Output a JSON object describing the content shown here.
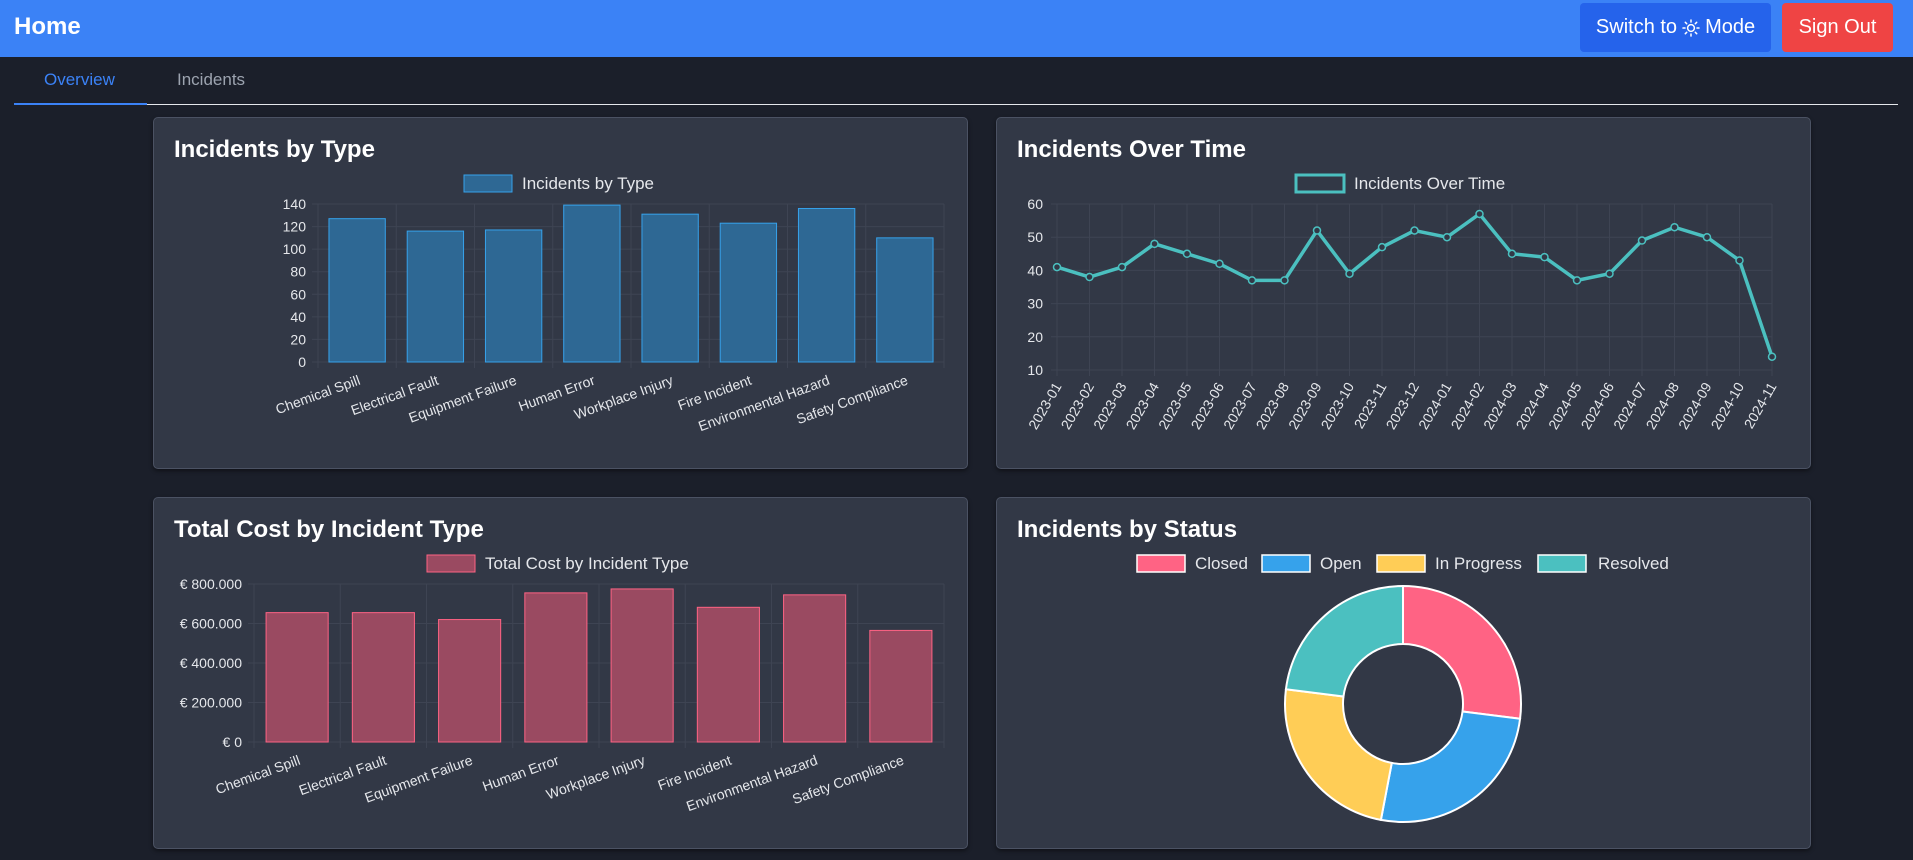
{
  "header": {
    "title": "Home",
    "theme_button": {
      "prefix": "Switch to",
      "icon": "sun-icon",
      "suffix": "Mode"
    },
    "signout_label": "Sign Out"
  },
  "tabs": [
    {
      "label": "Overview",
      "active": true
    },
    {
      "label": "Incidents",
      "active": false
    }
  ],
  "colors": {
    "header_bg": "#3b82f6",
    "accent": "#3b82f6",
    "signout": "#ef4444",
    "bar_blue": "#2e6894",
    "bar_red": "#9a4a61",
    "line_teal": "#4bc0c0",
    "pie": [
      "#ff6384",
      "#36a2eb",
      "#ffcd56",
      "#4bc0c0"
    ]
  },
  "charts": {
    "by_type": {
      "title": "Incidents by Type",
      "chart_data": {
        "type": "bar",
        "legend": "Incidents by Type",
        "categories": [
          "Chemical Spill",
          "Electrical Fault",
          "Equipment Failure",
          "Human Error",
          "Workplace Injury",
          "Fire Incident",
          "Environmental Hazard",
          "Safety Compliance"
        ],
        "values": [
          127,
          116,
          117,
          139,
          131,
          123,
          136,
          110
        ],
        "ylim": [
          0,
          140
        ],
        "yticks": [
          "0",
          "20",
          "40",
          "60",
          "80",
          "100",
          "120",
          "140"
        ]
      }
    },
    "over_time": {
      "title": "Incidents Over Time",
      "chart_data": {
        "type": "line",
        "legend": "Incidents Over Time",
        "x": [
          "2023-01",
          "2023-02",
          "2023-03",
          "2023-04",
          "2023-05",
          "2023-06",
          "2023-07",
          "2023-08",
          "2023-09",
          "2023-10",
          "2023-11",
          "2023-12",
          "2024-01",
          "2024-02",
          "2024-03",
          "2024-04",
          "2024-05",
          "2024-06",
          "2024-07",
          "2024-08",
          "2024-09",
          "2024-10",
          "2024-11"
        ],
        "values": [
          41,
          38,
          41,
          48,
          45,
          42,
          37,
          37,
          52,
          39,
          47,
          52,
          50,
          57,
          45,
          44,
          37,
          39,
          49,
          53,
          50,
          43,
          14
        ],
        "ylim": [
          10,
          60
        ],
        "yticks": [
          "10",
          "20",
          "30",
          "40",
          "50",
          "60"
        ]
      }
    },
    "cost_by_type": {
      "title": "Total Cost by Incident Type",
      "chart_data": {
        "type": "bar",
        "legend": "Total Cost by Incident Type",
        "categories": [
          "Chemical Spill",
          "Electrical Fault",
          "Equipment Failure",
          "Human Error",
          "Workplace Injury",
          "Fire Incident",
          "Environmental Hazard",
          "Safety Compliance"
        ],
        "values": [
          655000,
          655000,
          620000,
          755000,
          775000,
          682000,
          745000,
          565000
        ],
        "ylim": [
          0,
          800000
        ],
        "yticks": [
          "€ 0",
          "€ 200.000",
          "€ 400.000",
          "€ 600.000",
          "€ 800.000"
        ]
      }
    },
    "by_status": {
      "title": "Incidents by Status",
      "chart_data": {
        "type": "pie",
        "categories": [
          "Closed",
          "Open",
          "In Progress",
          "Resolved"
        ],
        "values": [
          27,
          26,
          24,
          23
        ]
      }
    }
  }
}
